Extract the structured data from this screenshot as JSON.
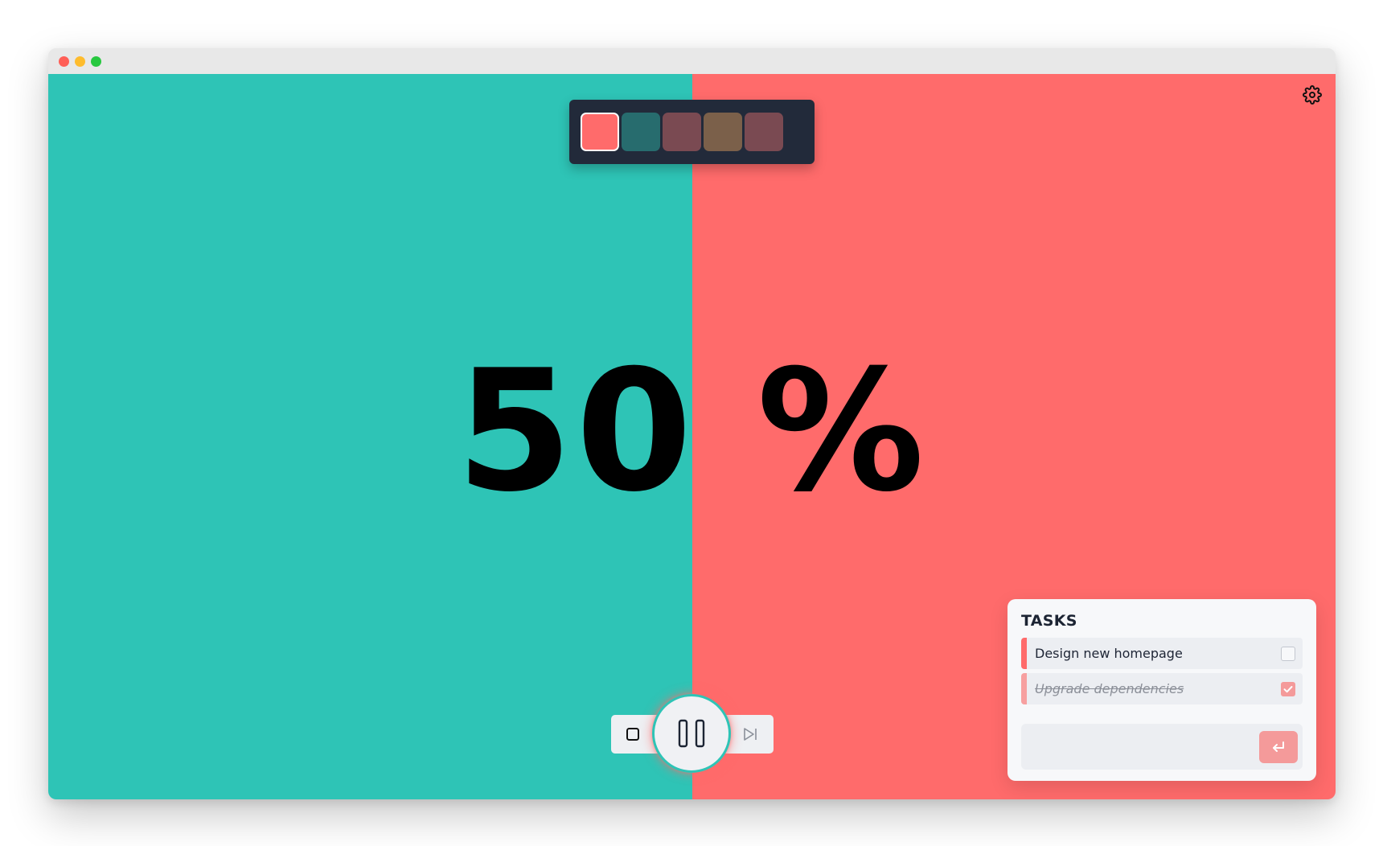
{
  "window": {
    "buttons": [
      "close",
      "minimize",
      "maximize"
    ],
    "colors": {
      "close": "#ff5f57",
      "minimize": "#febc2e",
      "maximize": "#28c840"
    }
  },
  "timer": {
    "display": "50 %",
    "progress_percent": 50,
    "colors": {
      "elapsed": "#2ec4b6",
      "remaining": "#ff6b6b"
    }
  },
  "swatches": {
    "items": [
      {
        "color": "#ff6b6b",
        "selected": true
      },
      {
        "color": "#276c6e",
        "selected": false
      },
      {
        "color": "#7a4a52",
        "selected": false
      },
      {
        "color": "#7b604a",
        "selected": false
      },
      {
        "color": "#7a4a52",
        "selected": false
      }
    ]
  },
  "settings": {
    "icon": "gear-icon"
  },
  "controls": {
    "stop_icon": "stop-icon",
    "pause_icon": "pause-icon",
    "skip_icon": "skip-next-icon"
  },
  "tasks": {
    "title": "TASKS",
    "items": [
      {
        "label": "Design new homepage",
        "done": false,
        "accent": "#ff6b6b"
      },
      {
        "label": "Upgrade dependencies",
        "done": true,
        "accent": "#f7a0a0"
      }
    ],
    "input": {
      "value": "",
      "placeholder": ""
    },
    "submit_icon": "enter-icon",
    "submit_color": "#f49a9a"
  }
}
